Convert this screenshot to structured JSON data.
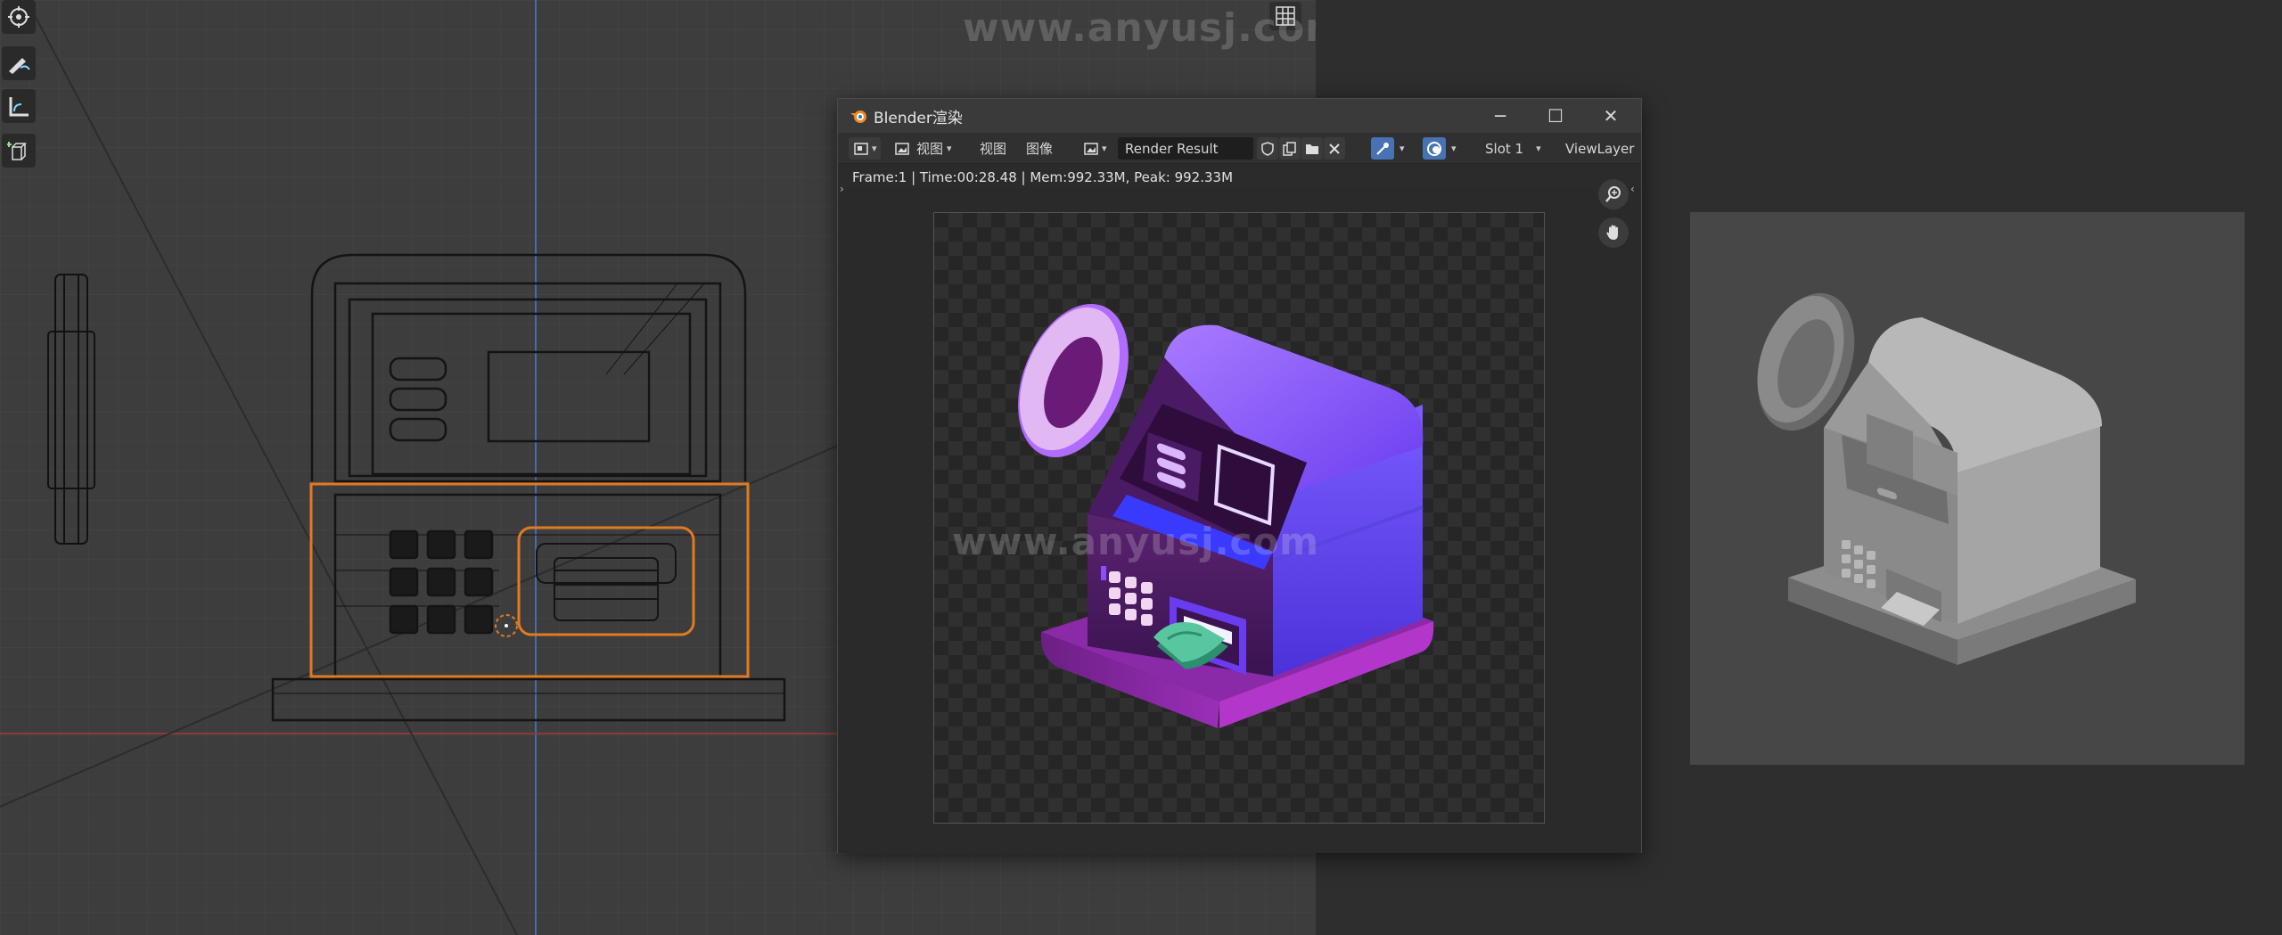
{
  "viewport": {
    "watermark_top": "www.anyusj.com"
  },
  "render_window": {
    "title": "Blender渲染",
    "controls": {
      "minimize": "─",
      "maximize": "☐",
      "close": "✕"
    },
    "toolbar": {
      "view_menu_1": "视图",
      "view_menu_2": "视图",
      "image_menu": "图像",
      "image_name": "Render Result",
      "slot": "Slot 1",
      "view_layer": "ViewLayer"
    },
    "status": "Frame:1 | Time:00:28.48 | Mem:992.33M, Peak: 992.33M",
    "image_watermark": "www.anyusj.com"
  },
  "colors": {
    "selection_orange": "#e07b22",
    "atm_purple": "#5e1f6e",
    "atm_violet": "#8b4dff",
    "cash_green": "#58c7a0",
    "active_blue": "#4772b3"
  }
}
